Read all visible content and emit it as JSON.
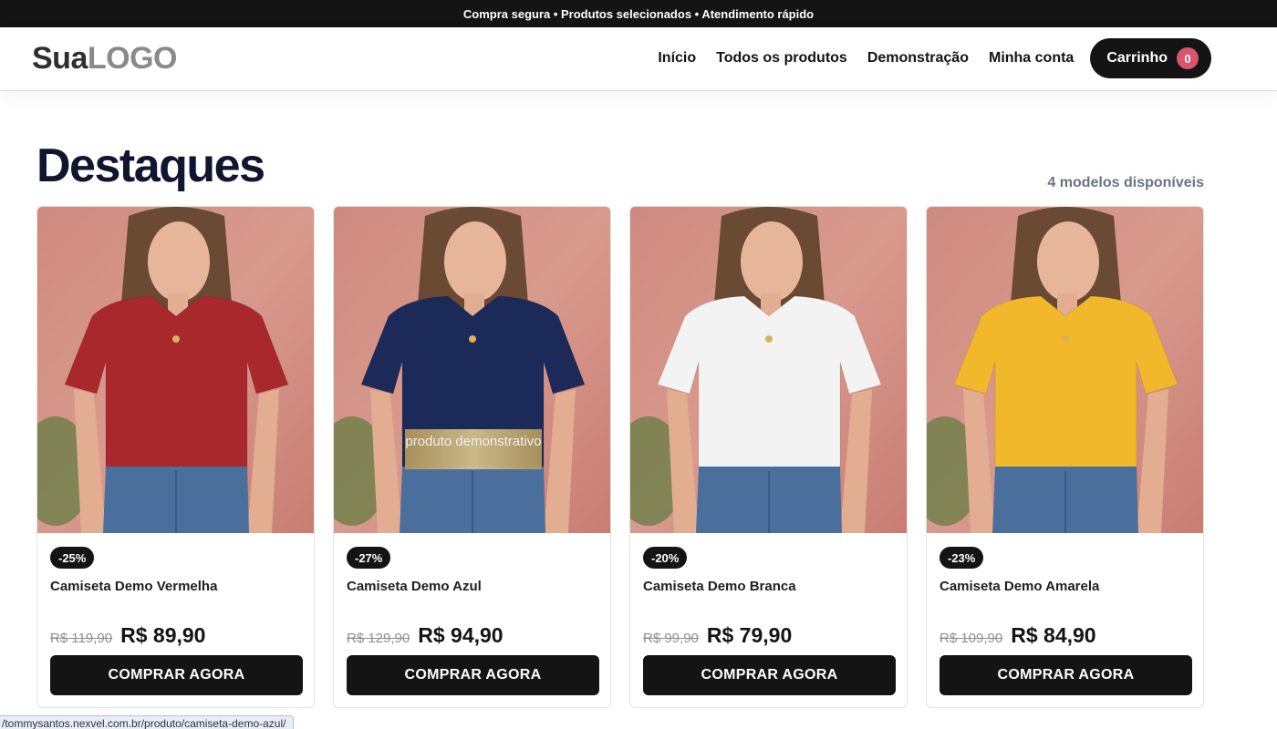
{
  "topbar": {
    "text": "Compra segura • Produtos selecionados • Atendimento rápido"
  },
  "header": {
    "logo_part1": "Sua",
    "logo_part2": "LOGO",
    "nav": [
      {
        "label": "Início"
      },
      {
        "label": "Todos os produtos"
      },
      {
        "label": "Demonstração"
      },
      {
        "label": "Minha conta"
      }
    ],
    "cart": {
      "label": "Carrinho",
      "count": "0"
    }
  },
  "section": {
    "title": "Destaques",
    "count_text": "4 modelos disponíveis"
  },
  "products": [
    {
      "name": "Camiseta Demo Vermelha",
      "discount": "-25%",
      "old_price": "R$ 119,90",
      "price": "R$ 89,90",
      "cta": "COMPRAR AGORA",
      "shirt_color": "#a8282b"
    },
    {
      "name": "Camiseta Demo Azul",
      "discount": "-27%",
      "old_price": "R$ 129,90",
      "price": "R$ 94,90",
      "cta": "COMPRAR AGORA",
      "shirt_color": "#1c2a5a",
      "stamp": "produto demonstrativo"
    },
    {
      "name": "Camiseta Demo Branca",
      "discount": "-20%",
      "old_price": "R$ 99,90",
      "price": "R$ 79,90",
      "cta": "COMPRAR AGORA",
      "shirt_color": "#f3f3f3"
    },
    {
      "name": "Camiseta Demo Amarela",
      "discount": "-23%",
      "old_price": "R$ 109,90",
      "price": "R$ 84,90",
      "cta": "COMPRAR AGORA",
      "shirt_color": "#f2b82c"
    }
  ],
  "status_bar": {
    "url": "/tommysantos.nexvel.com.br/produto/camiseta-demo-azul/"
  },
  "colors": {
    "accent": "#141414",
    "badge": "#d9546f",
    "background_photo": "#d99a8e"
  }
}
